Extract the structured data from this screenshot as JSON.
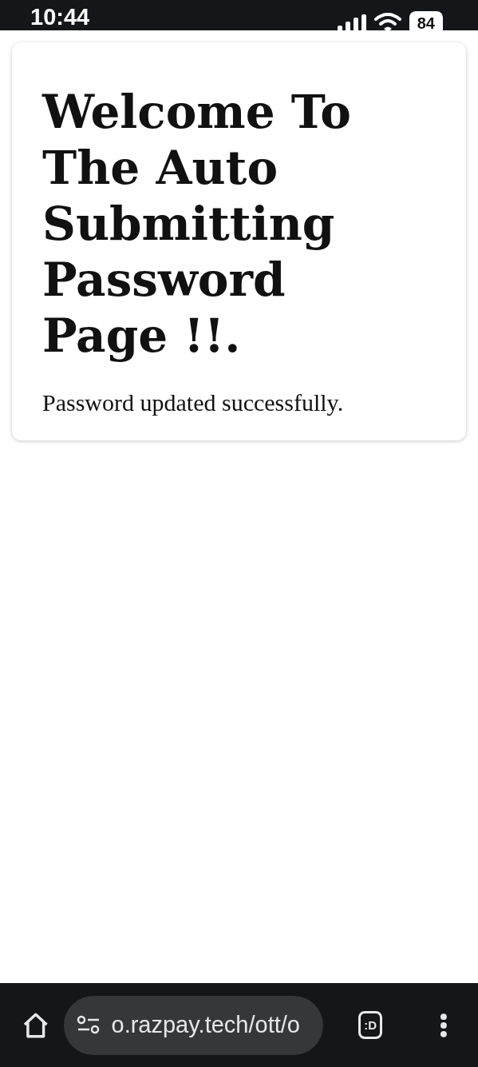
{
  "status_bar": {
    "time": "10:44",
    "battery": "84"
  },
  "card": {
    "heading": "Welcome To The Auto Submitting Password Page !!.",
    "message": "Password updated successfully."
  },
  "browser_bar": {
    "url": "o.razpay.tech/ott/o",
    "tabs": ":D"
  }
}
